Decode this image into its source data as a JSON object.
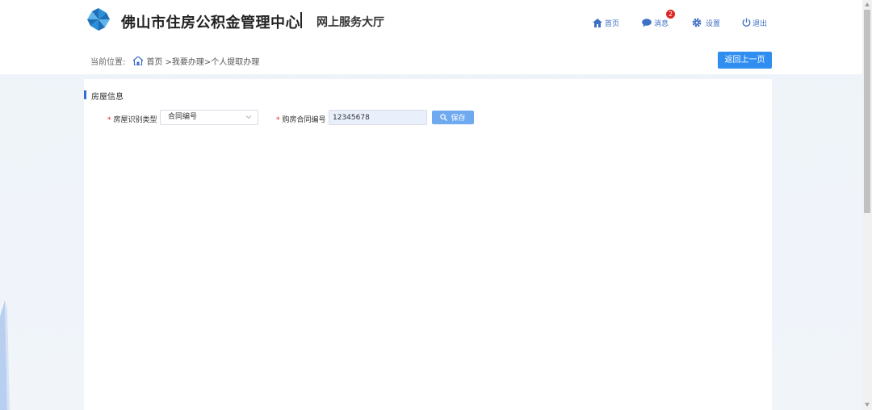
{
  "header": {
    "site_title": "佛山市住房公积金管理中心",
    "site_subtitle": "网上服务大厅",
    "nav": [
      {
        "label": "首页",
        "icon": "home-icon"
      },
      {
        "label": "消息",
        "icon": "message-icon",
        "badge": "2"
      },
      {
        "label": "设置",
        "icon": "gear-icon"
      },
      {
        "label": "退出",
        "icon": "power-icon"
      }
    ]
  },
  "breadcrumb": {
    "prefix": "当前位置:",
    "path": "首页 >我要办理>个人提取办理"
  },
  "back_button": "返回上一页",
  "section": {
    "title": "房屋信息"
  },
  "form": {
    "house_type_label": "房屋识别类型",
    "house_type_value": "合同编号",
    "contract_label": "购房合同编号",
    "contract_value": "12345678",
    "save_button": "保存"
  },
  "colors": {
    "accent": "#2f8ef0",
    "nav_text": "#3d6fc4",
    "required": "#e02424"
  }
}
